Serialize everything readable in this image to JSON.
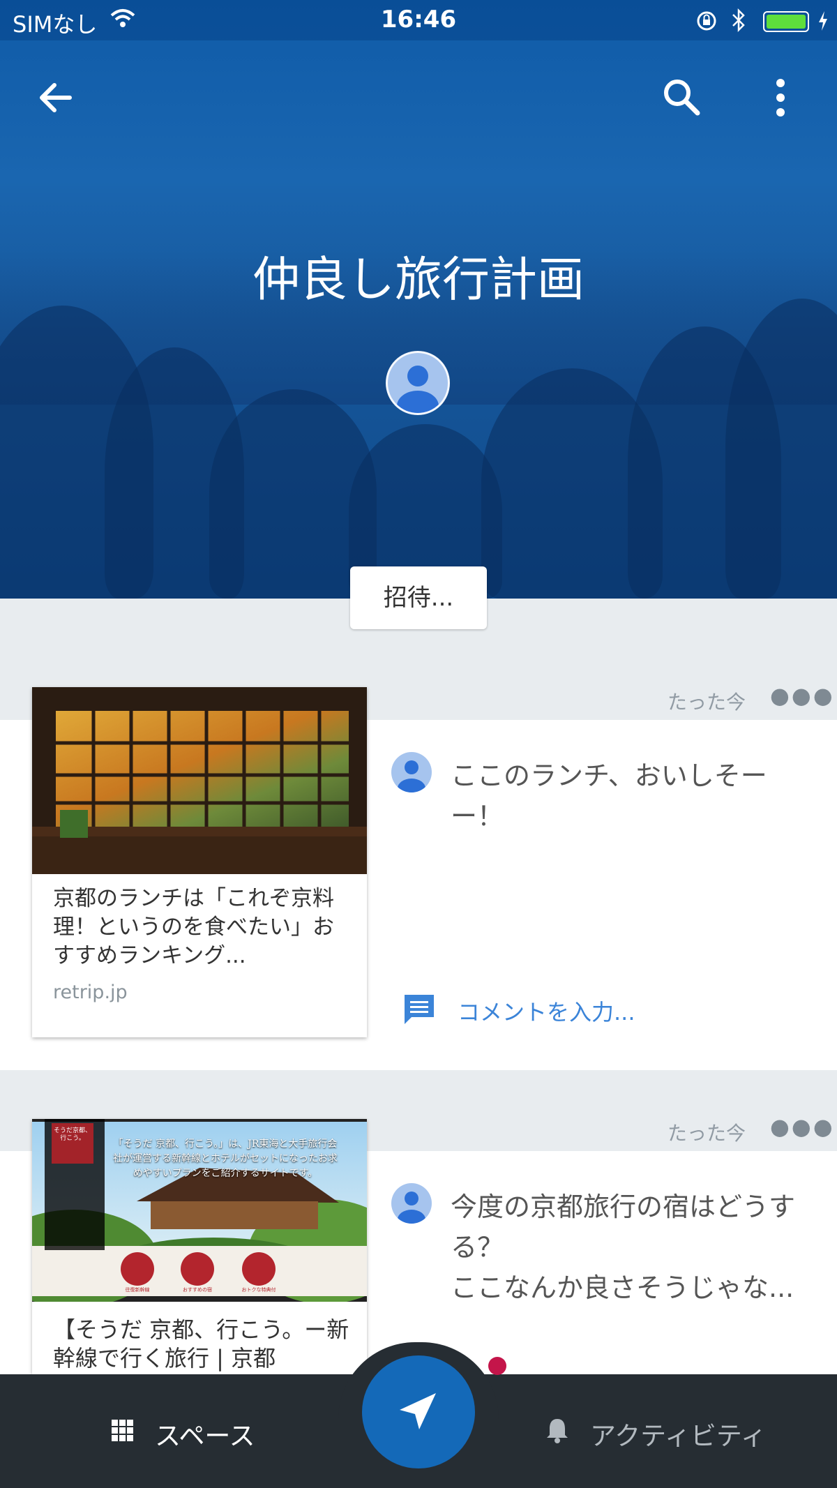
{
  "status_bar": {
    "carrier": "SIMなし",
    "time": "16:46",
    "wifi_icon": "wifi-icon",
    "lock_icon": "orientation-lock-icon",
    "bluetooth_icon": "bluetooth-icon",
    "battery_icon": "battery-icon",
    "charging_icon": "charging-bolt-icon",
    "battery_level": 1.0
  },
  "header": {
    "back_icon": "back-arrow-icon",
    "search_icon": "search-icon",
    "menu_icon": "more-vert-icon",
    "title": "仲良し旅行計画",
    "invite_label": "招待..."
  },
  "posts": [
    {
      "time": "たった今",
      "link_title": "京都のランチは「これぞ京料理！というのを食べたい」おすすめランキング...",
      "link_domain": "retrip.jp",
      "comment": "ここのランチ、おいしそーー！",
      "add_comment": "コメントを入力..."
    },
    {
      "time": "たった今",
      "link_title": "【そうだ 京都、行こう。ー新幹線で行く旅行 | 京都",
      "comment": "今度の京都旅行の宿はどうする？\nここなんか良さそうじゃな...",
      "image_text": {
        "seal": "そうだ京都、行こう。",
        "caption": "「そうだ 京都、行こう。」は、JR東海と大手旅行会社が運営する新幹線とホテルがセットになったお求めやすいプランをご紹介するサイトです。",
        "icon_labels": [
          "往復新幹線",
          "おすすめの宿",
          "おトクな特典付"
        ]
      }
    }
  ],
  "bottom_nav": {
    "spaces_label": "スペース",
    "activity_label": "アクティビティ",
    "spaces_icon": "grid-icon",
    "activity_icon": "bell-icon",
    "fab_icon": "send-icon"
  },
  "colors": {
    "header_blue": "#1762ad",
    "fab_blue": "#1469b8",
    "link_blue": "#3b84d8",
    "bottom_bar": "#262d33"
  }
}
